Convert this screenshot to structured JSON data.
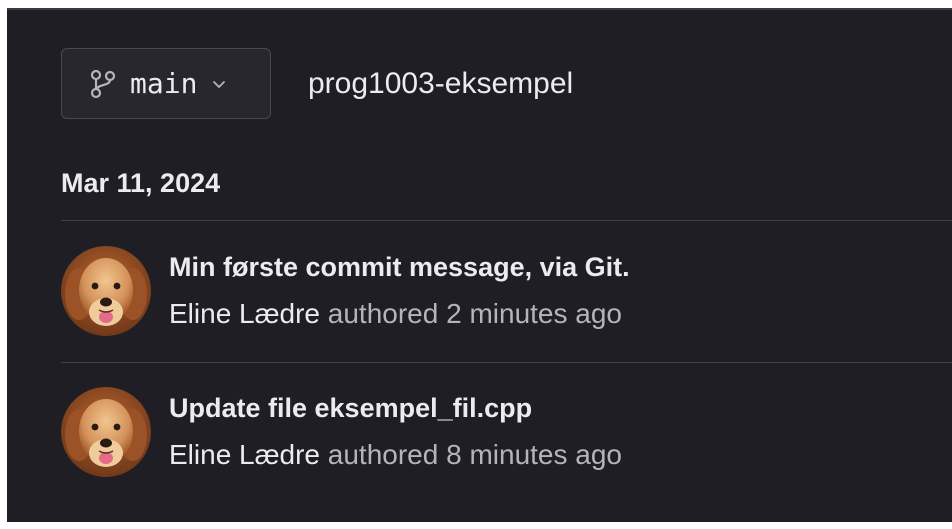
{
  "branch_selector": {
    "branch_name": "main",
    "icon": "git-branch-icon",
    "dropdown_icon": "chevron-down-icon"
  },
  "repository": {
    "name": "prog1003-eksempel"
  },
  "commit_group": {
    "date": "Mar 11, 2024"
  },
  "commits": [
    {
      "title": "Min første commit message, via Git.",
      "author": "Eline Lædre",
      "action": "authored",
      "time": "2 minutes ago",
      "avatar": "golden-retriever-avatar"
    },
    {
      "title": "Update file eksempel_fil.cpp",
      "author": "Eline Lædre",
      "action": "authored",
      "time": "8 minutes ago",
      "avatar": "golden-retriever-avatar"
    }
  ],
  "colors": {
    "background": "#1f1e24",
    "text_primary": "#ececef",
    "text_secondary": "#b5b4bb",
    "border": "#4a4950"
  }
}
